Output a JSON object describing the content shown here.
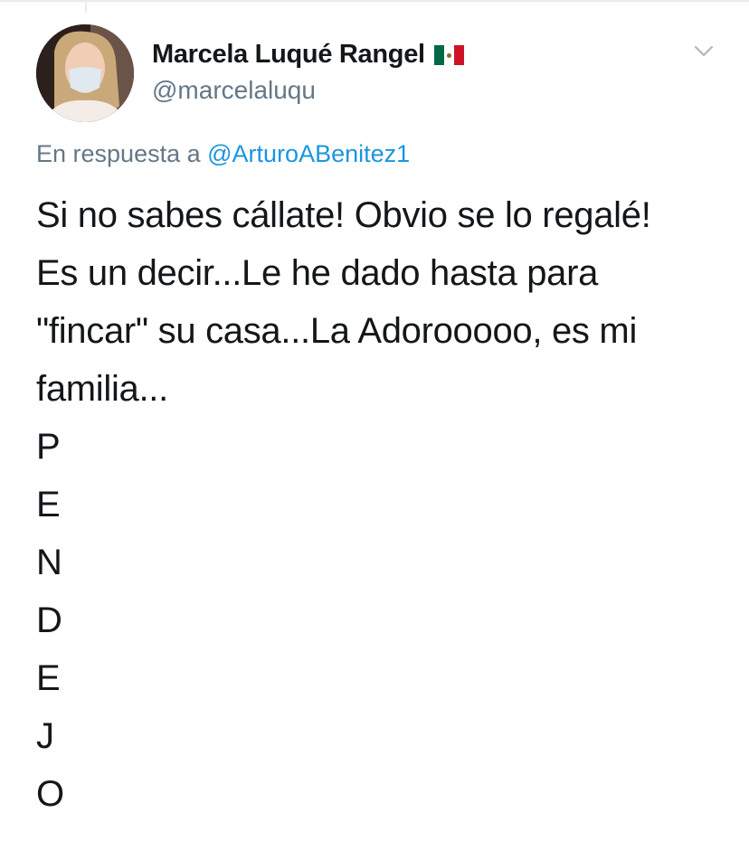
{
  "tweet": {
    "author": {
      "name": "Marcela Luqué Rangel",
      "flag_icon": "mexico-flag-icon",
      "handle": "@marcelaluqu"
    },
    "reply_prefix": "En respuesta a",
    "reply_to": "@ArturoABenitez1",
    "text_lines": [
      "Si no sabes cállate! Obvio se lo regalé!",
      "Es un decir...Le he dado hasta para",
      "\"fincar\" su casa...La Adorooooo, es mi",
      "familia..."
    ],
    "letters": [
      "P",
      "E",
      "N",
      "D",
      "E",
      "J",
      "O"
    ],
    "colors": {
      "link": "#1b95e0",
      "secondary": "#657786",
      "text": "#14171a"
    }
  }
}
